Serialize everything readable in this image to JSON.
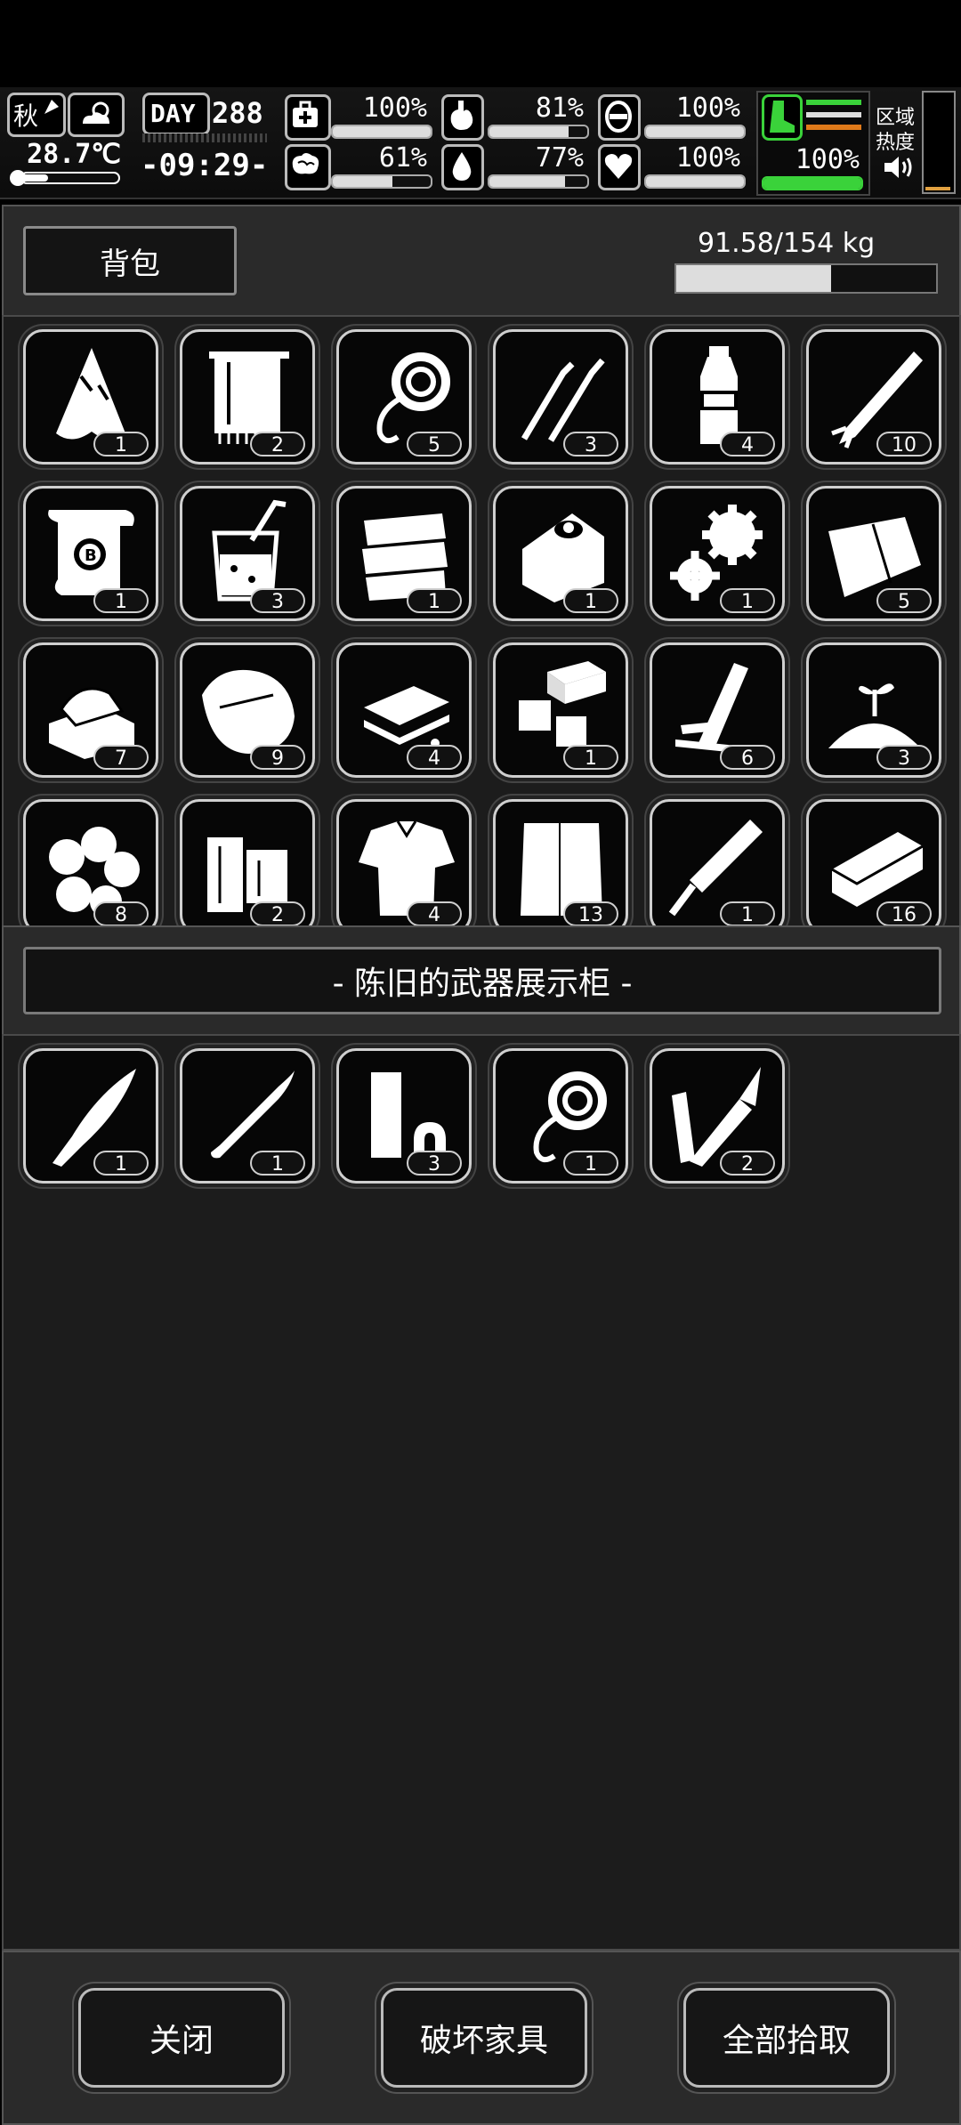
{
  "status": {
    "season": "秋",
    "temperature": "28.7℃",
    "day_label": "DAY",
    "day_number": "288",
    "time": "-09:29-",
    "stats": [
      {
        "name": "health",
        "icon": "medkit-icon",
        "value": "100%",
        "level": 1.0
      },
      {
        "name": "hunger",
        "icon": "stomach-icon",
        "value": "81%",
        "level": 0.81
      },
      {
        "name": "armor",
        "icon": "shield-icon",
        "value": "100%",
        "level": 1.0
      },
      {
        "name": "mood",
        "icon": "brain-icon",
        "value": "61%",
        "level": 0.61
      },
      {
        "name": "thirst",
        "icon": "water-drop-icon",
        "value": "77%",
        "level": 0.77
      },
      {
        "name": "heart",
        "icon": "heart-icon",
        "value": "100%",
        "level": 1.0
      }
    ],
    "stamina": {
      "value": "100%",
      "level": 1.0
    },
    "area_heat_label_1": "区域",
    "area_heat_label_2": "热度",
    "colors": {
      "stamina_green": "#3ad23a",
      "stamina_orange": "#e07a1a"
    }
  },
  "backpack": {
    "tab_label": "背包",
    "weight_text": "91.58/154 kg",
    "weight_level": 0.595,
    "items": [
      {
        "name": "cloth-rag",
        "icon": "rag-icon",
        "count": "1"
      },
      {
        "name": "towel",
        "icon": "towel-icon",
        "count": "2"
      },
      {
        "name": "rope",
        "icon": "rope-icon",
        "count": "5"
      },
      {
        "name": "lockpicks",
        "icon": "lockpick-icon",
        "count": "3"
      },
      {
        "name": "water-bottle",
        "icon": "bottle-icon",
        "count": "4"
      },
      {
        "name": "rocket",
        "icon": "rocket-icon",
        "count": "10"
      },
      {
        "name": "blueprint",
        "icon": "scroll-icon",
        "count": "1"
      },
      {
        "name": "juice",
        "icon": "cup-icon",
        "count": "3"
      },
      {
        "name": "fabric-stack",
        "icon": "fabric-icon",
        "count": "1"
      },
      {
        "name": "canned-food",
        "icon": "can-icon",
        "count": "1"
      },
      {
        "name": "gears",
        "icon": "gears-icon",
        "count": "1"
      },
      {
        "name": "folded-cloth",
        "icon": "cloth-icon",
        "count": "5"
      },
      {
        "name": "towels",
        "icon": "folded-towel-icon",
        "count": "7"
      },
      {
        "name": "sack",
        "icon": "sack-icon",
        "count": "9"
      },
      {
        "name": "planks",
        "icon": "planks-icon",
        "count": "4"
      },
      {
        "name": "bricks",
        "icon": "bricks-icon",
        "count": "1"
      },
      {
        "name": "wood-boards",
        "icon": "boards-icon",
        "count": "6"
      },
      {
        "name": "soil",
        "icon": "soil-sprout-icon",
        "count": "3"
      },
      {
        "name": "cotton-balls",
        "icon": "cotton-icon",
        "count": "8"
      },
      {
        "name": "logs",
        "icon": "logs-icon",
        "count": "2"
      },
      {
        "name": "torn-shirt",
        "icon": "shirt-icon",
        "count": "4"
      },
      {
        "name": "cloth-sheet",
        "icon": "sheet-icon",
        "count": "13"
      },
      {
        "name": "file-tool",
        "icon": "file-icon",
        "count": "1"
      },
      {
        "name": "metal-block",
        "icon": "ingot-icon",
        "count": "16"
      }
    ]
  },
  "container": {
    "title": "- 陈旧的武器展示柜 -",
    "items": [
      {
        "name": "machete",
        "icon": "machete-icon",
        "count": "1"
      },
      {
        "name": "bullet",
        "icon": "bullet-icon",
        "count": "1"
      },
      {
        "name": "pipes",
        "icon": "pipe-icon",
        "count": "3"
      },
      {
        "name": "rope",
        "icon": "rope-icon",
        "count": "1"
      },
      {
        "name": "soldering-iron",
        "icon": "soldering-icon",
        "count": "2"
      }
    ]
  },
  "buttons": {
    "close": "关闭",
    "destroy": "破坏家具",
    "take_all": "全部拾取"
  }
}
